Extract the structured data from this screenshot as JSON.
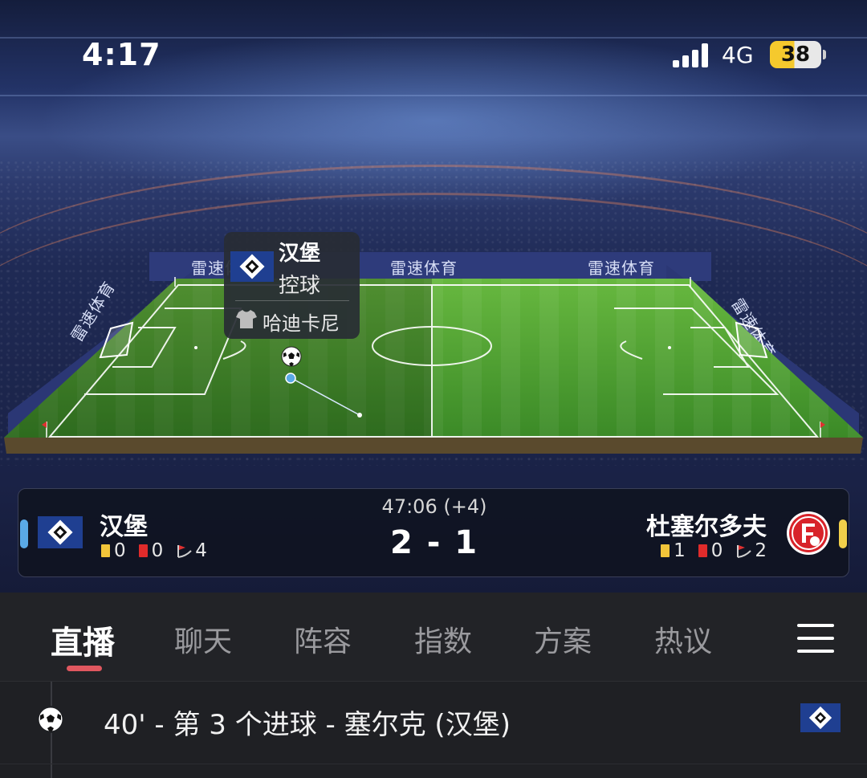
{
  "status_bar": {
    "time": "4:17",
    "network": "4G",
    "battery": "38"
  },
  "ad_boards": [
    "雷速体育",
    "雷速体育",
    "雷速体育",
    "雷速体育",
    "雷速体育"
  ],
  "possession": {
    "team": "汉堡",
    "state": "控球",
    "player": "哈迪卡尼"
  },
  "match": {
    "clock": "47:06 (+4)",
    "score": "2 - 1",
    "home": {
      "name": "汉堡",
      "yellow": "0",
      "red": "0",
      "corners": "4",
      "color": "#5aa9e6"
    },
    "away": {
      "name": "杜塞尔多夫",
      "yellow": "1",
      "red": "0",
      "corners": "2",
      "color": "#f2d04a"
    }
  },
  "tabs": [
    {
      "label": "直播",
      "active": true
    },
    {
      "label": "聊天"
    },
    {
      "label": "阵容"
    },
    {
      "label": "指数"
    },
    {
      "label": "方案"
    },
    {
      "label": "热议"
    }
  ],
  "events": [
    {
      "text": "40' - 第 3 个进球 - 塞尔克 (汉堡)",
      "icon": "soccer-ball-icon"
    }
  ],
  "colors": {
    "accent": "#e0575f",
    "home_primary": "#1f3f91",
    "away_primary": "#d8232a",
    "pitch": "#3f8f2a"
  }
}
